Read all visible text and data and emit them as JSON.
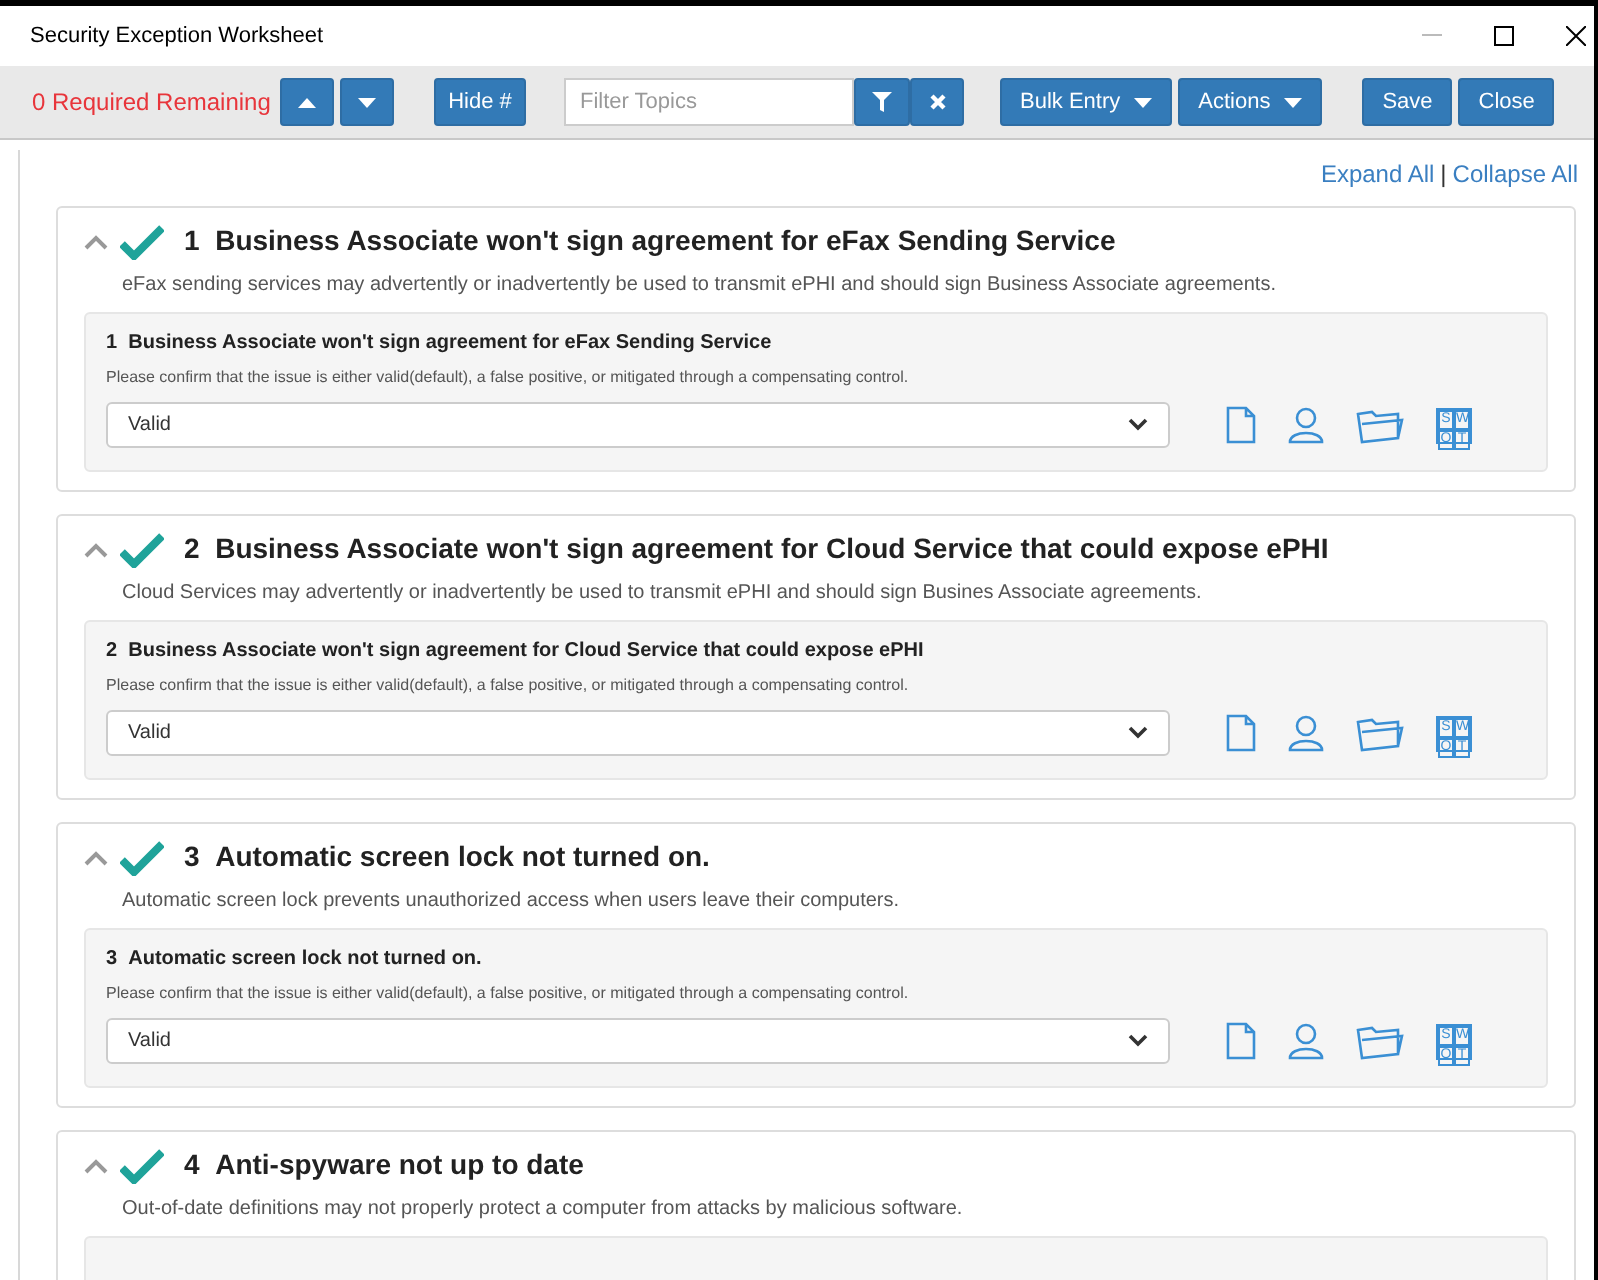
{
  "window": {
    "title": "Security Exception Worksheet"
  },
  "toolbar": {
    "status": "0 Required Remaining",
    "hide_label": "Hide #",
    "filter": {
      "placeholder": "Filter Topics"
    },
    "menus": [
      "Bulk Entry",
      "Actions"
    ],
    "actions": [
      "Save",
      "Close"
    ]
  },
  "links": {
    "expand": "Expand All",
    "separator": "|",
    "collapse": "Collapse All"
  },
  "topics": [
    {
      "number": "1",
      "title": "Business Associate won't sign agreement for eFax Sending Service",
      "checked": true,
      "expanded": true,
      "description": "eFax sending services may advertently or inadvertently be used to transmit ePHI and should sign Business Associate agreements.",
      "question": {
        "number": "1",
        "title": "Business Associate won't sign agreement for eFax Sending Service",
        "hint": "Please confirm that the issue is either valid(default), a false positive, or mitigated through a compensating control.",
        "value": "Valid",
        "swot": [
          "S",
          "W",
          "O",
          "T"
        ]
      }
    },
    {
      "number": "2",
      "title": "Business Associate won't sign agreement for Cloud Service that could expose ePHI",
      "checked": true,
      "expanded": true,
      "description": "Cloud Services may advertently or inadvertently be used to transmit ePHI and should sign Busines Associate agreements.",
      "question": {
        "number": "2",
        "title": "Business Associate won't sign agreement for Cloud Service that could expose ePHI",
        "hint": "Please confirm that the issue is either valid(default), a false positive, or mitigated through a compensating control.",
        "value": "Valid",
        "swot": [
          "S",
          "W",
          "O",
          "T"
        ]
      }
    },
    {
      "number": "3",
      "title": "Automatic screen lock not turned on.",
      "checked": true,
      "expanded": true,
      "description": "Automatic screen lock prevents unauthorized access when users leave their computers.",
      "question": {
        "number": "3",
        "title": "Automatic screen lock not turned on.",
        "hint": "Please confirm that the issue is either valid(default), a false positive, or mitigated through a compensating control.",
        "value": "Valid",
        "swot": [
          "S",
          "W",
          "O",
          "T"
        ]
      }
    },
    {
      "number": "4",
      "title": "Anti-spyware not up to date",
      "checked": true,
      "expanded": true,
      "description": "Out-of-date definitions may not properly protect a computer from attacks by malicious software."
    }
  ]
}
